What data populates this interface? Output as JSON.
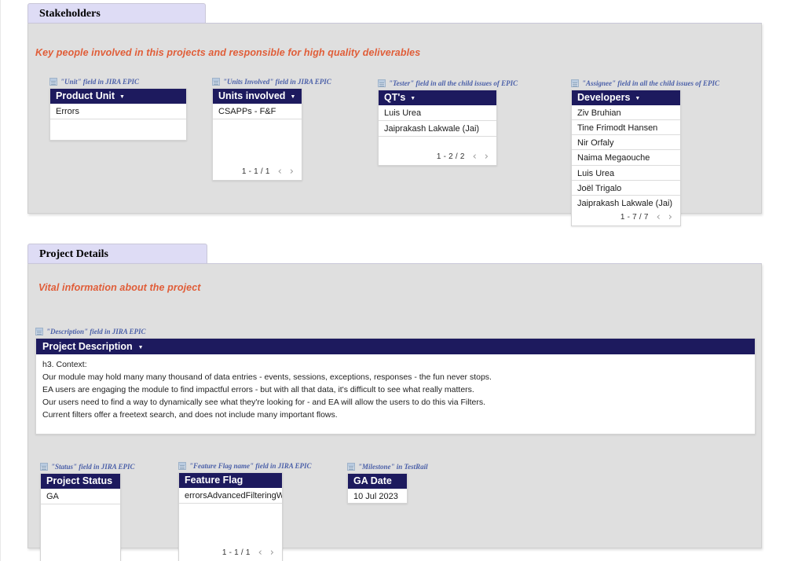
{
  "sections": [
    {
      "tab_label": "Stakeholders",
      "subtitle": "Key people involved in this projects and responsible for high quality deliverables",
      "cards": [
        {
          "field_label": "\"Unit\" field in JIRA EPIC",
          "icon": "grid-icon",
          "header": "Product Unit",
          "rows": [
            "Errors"
          ],
          "pager": null
        },
        {
          "field_label": "\"Units Involved\" field in JIRA EPIC",
          "icon": "grid-icon",
          "header": "Units involved",
          "rows": [
            "CSAPPs - F&F"
          ],
          "pager": "1 - 1 / 1"
        },
        {
          "field_label": "\"Tester\" field in all the child issues of  EPIC",
          "icon": "grid-icon",
          "header": "QT's",
          "rows": [
            "Luis Urea",
            "Jaiprakash Lakwale (Jai)"
          ],
          "pager": "1 - 2 / 2"
        },
        {
          "field_label": "\"Assignee\" field in all the child issues of EPIC",
          "icon": "grid-icon",
          "header": "Developers",
          "rows": [
            "Ziv Bruhian",
            "Tine Frimodt Hansen",
            "Nir Orfaly",
            "Naima Megaouche",
            "Luis Urea",
            "Joël Trigalo",
            "Jaiprakash Lakwale (Jai)"
          ],
          "pager": "1 - 7 / 7"
        }
      ]
    },
    {
      "tab_label": "Project Details",
      "subtitle": "Vital information about the project",
      "description": {
        "field_label": "\"Description\" field in JIRA EPIC",
        "icon": "grid-icon",
        "header": "Project Description",
        "lines": [
          "h3. Context:",
          "Our module may hold many many thousand of data entries - events, sessions, exceptions, responses - the fun never stops.",
          "EA users are engaging the module to find impactful errors - but with all that data, it's difficult to see what really matters.",
          "Our users need to find a way to dynamically see what they're looking for - and EA will allow the users to do this via Filters.",
          "Current filters offer a freetext search, and does not include many important flows."
        ]
      },
      "cards": [
        {
          "field_label": "\"Status\" field in JIRA EPIC",
          "icon": "grid-icon",
          "header": "Project Status",
          "rows": [
            "GA"
          ],
          "pager": null
        },
        {
          "field_label": "\"Feature Flag name\" field in JIRA EPIC",
          "icon": "grid-icon",
          "header": "Feature Flag",
          "rows": [
            "errorsAdvancedFilteringWeb"
          ],
          "pager": "1 - 1 / 1"
        },
        {
          "field_label": "\"Milestone\" in TestRail",
          "icon": "grid-icon",
          "header": "GA Date",
          "rows": [
            "10 Jul 2023"
          ],
          "pager": null
        }
      ]
    }
  ],
  "pager_controls": {
    "prev": "‹",
    "next": "›"
  },
  "caret": "▼",
  "colors": {
    "card_header_bg": "#1d1a5e",
    "section_tab_bg": "#dedcf5",
    "panel_bg": "#dfdfdf",
    "subtitle_text": "#e05d38",
    "field_label_text": "#4a5fa8"
  }
}
